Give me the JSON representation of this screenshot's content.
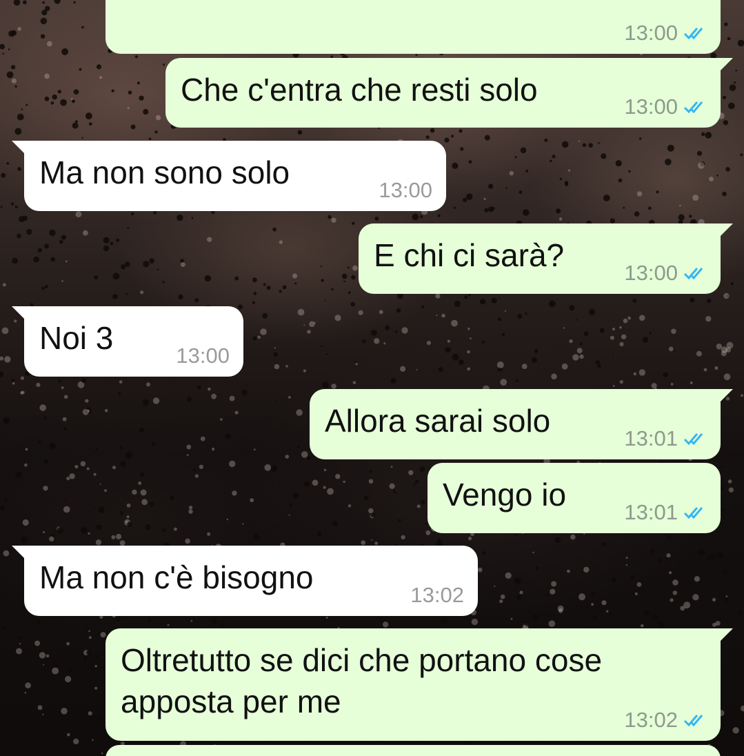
{
  "chat": {
    "messages": [
      {
        "direction": "out",
        "text": "",
        "time": "13:00",
        "status": "read"
      },
      {
        "direction": "out",
        "text": "Che c'entra che resti solo",
        "time": "13:00",
        "status": "read"
      },
      {
        "direction": "in",
        "text": "Ma non sono solo",
        "time": "13:00"
      },
      {
        "direction": "out",
        "text": "E chi ci sarà?",
        "time": "13:00",
        "status": "read"
      },
      {
        "direction": "in",
        "text": "Noi 3",
        "time": "13:00"
      },
      {
        "direction": "out",
        "text": "Allora sarai solo",
        "time": "13:01",
        "status": "read"
      },
      {
        "direction": "out",
        "text": "Vengo io",
        "time": "13:01",
        "status": "read"
      },
      {
        "direction": "in",
        "text": "Ma non c'è bisogno",
        "time": "13:02"
      },
      {
        "direction": "out",
        "text": "Oltretutto se dici che portano cose apposta per me",
        "time": "13:02",
        "status": "read"
      },
      {
        "direction": "out",
        "text": "",
        "time": "",
        "status": ""
      }
    ]
  },
  "colors": {
    "outgoing_bubble": "#e6ffd9",
    "incoming_bubble": "#ffffff",
    "read_check": "#34b7f1"
  },
  "icons": {
    "read_receipt": "double-check-icon"
  }
}
